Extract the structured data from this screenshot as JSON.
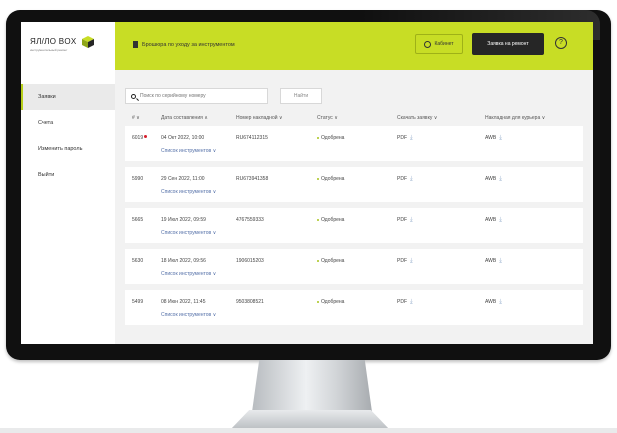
{
  "brand": {
    "logo_text": "ЯЛ/ЛО BOX",
    "tagline": "инструментальный ремонт",
    "accent": "#c8dd25",
    "dark": "#262626"
  },
  "sidebar": {
    "items": [
      {
        "label": "Заявки",
        "active": true
      },
      {
        "label": "Счета",
        "active": false
      },
      {
        "label": "Изменить пароль",
        "active": false
      },
      {
        "label": "Выйти",
        "active": false
      }
    ]
  },
  "header": {
    "notice": "Брошюра по уходу за инструментом",
    "cabinet_label": "Кабинет",
    "repair_button": "Заявка на ремонт",
    "help_glyph": "?"
  },
  "search": {
    "placeholder": "Поиск по серийному номеру",
    "button": "Найти"
  },
  "table": {
    "columns": {
      "id": "# ∨",
      "date": "Дата составления ∧",
      "invoice": "Номер накладной ∨",
      "status": "Статус ∨",
      "download": "Скачать заявку ∨",
      "courier": "Накладная для курьера ∨"
    },
    "tools_link": "Список инструментов ∨",
    "rows": [
      {
        "id": "6019",
        "is_new": true,
        "date": "04 Окт 2022, 10:00",
        "invoice": "RU674112315",
        "status": "Одобрена",
        "pdf": "PDF",
        "awb": "AWB"
      },
      {
        "id": "5990",
        "is_new": false,
        "date": "29 Сен 2022, 11:00",
        "invoice": "RU673941358",
        "status": "Одобрена",
        "pdf": "PDF",
        "awb": "AWB"
      },
      {
        "id": "5665",
        "is_new": false,
        "date": "19 Июл 2022, 09:59",
        "invoice": "4767559333",
        "status": "Одобрена",
        "pdf": "PDF",
        "awb": "AWB"
      },
      {
        "id": "5630",
        "is_new": false,
        "date": "18 Июл 2022, 09:56",
        "invoice": "1906015203",
        "status": "Одобрена",
        "pdf": "PDF",
        "awb": "AWB"
      },
      {
        "id": "5499",
        "is_new": false,
        "date": "08 Июн 2022, 11:45",
        "invoice": "9503808521",
        "status": "Одобрена",
        "pdf": "PDF",
        "awb": "AWB"
      }
    ]
  }
}
